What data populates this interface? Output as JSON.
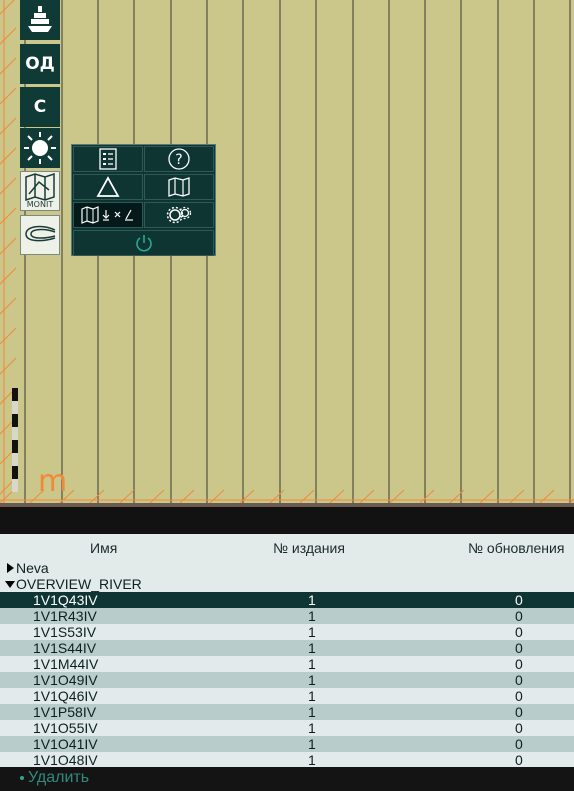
{
  "toolbar": {
    "od_label": "ОД",
    "c_label": "С",
    "monit_label": "MONIT"
  },
  "map": {
    "units_label": "m",
    "land_color": "#cbc78b",
    "grid_color": "#3a3a30",
    "edge_color": "#f08a3a"
  },
  "table": {
    "headers": {
      "name": "Имя",
      "edition": "№ издания",
      "update": "№ обновления"
    },
    "groups": [
      {
        "name": "Neva",
        "expanded": false
      },
      {
        "name": "OVERVIEW_RIVER",
        "expanded": true
      }
    ],
    "rows": [
      {
        "name": "1V1Q43IV",
        "edition": "1",
        "update": "0",
        "selected": true
      },
      {
        "name": "1V1R43IV",
        "edition": "1",
        "update": "0"
      },
      {
        "name": "1V1S53IV",
        "edition": "1",
        "update": "0"
      },
      {
        "name": "1V1S44IV",
        "edition": "1",
        "update": "0"
      },
      {
        "name": "1V1M44IV",
        "edition": "1",
        "update": "0"
      },
      {
        "name": "1V1O49IV",
        "edition": "1",
        "update": "0"
      },
      {
        "name": "1V1Q46IV",
        "edition": "1",
        "update": "0"
      },
      {
        "name": "1V1P58IV",
        "edition": "1",
        "update": "0"
      },
      {
        "name": "1V1O55IV",
        "edition": "1",
        "update": "0"
      },
      {
        "name": "1V1O41IV",
        "edition": "1",
        "update": "0"
      },
      {
        "name": "1V1O48IV",
        "edition": "1",
        "update": "0"
      }
    ]
  },
  "footer": {
    "delete_label": "Удалить"
  }
}
